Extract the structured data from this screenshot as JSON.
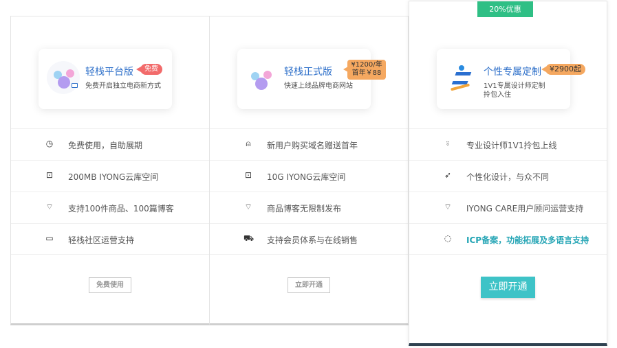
{
  "discount_badge": "20%优惠",
  "plans": [
    {
      "title": "轻栈平台版",
      "tag": "免费",
      "subtitle": "免费开启独立电商新方式",
      "features": [
        {
          "icon": "clock-icon",
          "glyph": "◷",
          "text": "免费使用，自助展期"
        },
        {
          "icon": "inbox-icon",
          "glyph": "⊡",
          "text": "200MB IYONG云库空间"
        },
        {
          "icon": "tag-icon",
          "glyph": "⌔",
          "text": "支持100件商品、100篇博客"
        },
        {
          "icon": "monitor-icon",
          "glyph": "▭",
          "text": "轻栈社区运营支持"
        }
      ],
      "button": "免费使用"
    },
    {
      "title": "轻栈正式版",
      "tag_line1": "¥1200/年",
      "tag_line2": "首年￥88",
      "subtitle": "快速上线品牌电商网站",
      "features": [
        {
          "icon": "award-icon",
          "glyph": "⍝",
          "text": "新用户购买域名赠送首年"
        },
        {
          "icon": "inbox-icon",
          "glyph": "⊡",
          "text": "10G IYONG云库空间"
        },
        {
          "icon": "tag-icon",
          "glyph": "⌔",
          "text": "商品博客无限制发布"
        },
        {
          "icon": "cart-icon",
          "glyph": "⛟",
          "text": "支持会员体系与在线销售"
        }
      ],
      "button": "立即开通"
    },
    {
      "title": "个性专属定制",
      "tag": "¥2900起",
      "subtitle_line1": "1V1专属设计师定制",
      "subtitle_line2": "拎包入住",
      "features": [
        {
          "icon": "user-icon",
          "glyph": "⍤",
          "text": "专业设计师1V1拎包上线"
        },
        {
          "icon": "rocket-icon",
          "glyph": "➶",
          "text": "个性化设计，与众不同"
        },
        {
          "icon": "tag-icon",
          "glyph": "⌔",
          "text": "IYONG CARE用户顾问运营支持"
        },
        {
          "icon": "chat-icon",
          "glyph": "◌",
          "text": "ICP备案，功能拓展及多语言支持"
        }
      ],
      "button": "立即开通"
    }
  ],
  "colors": {
    "accent_teal": "#3ec3c7",
    "title_blue": "#2d6fc9",
    "badge_green": "#2fbf85",
    "tag_red": "#f26b6b",
    "tag_orange": "#f5a860",
    "footer_dark": "#2e4150"
  }
}
